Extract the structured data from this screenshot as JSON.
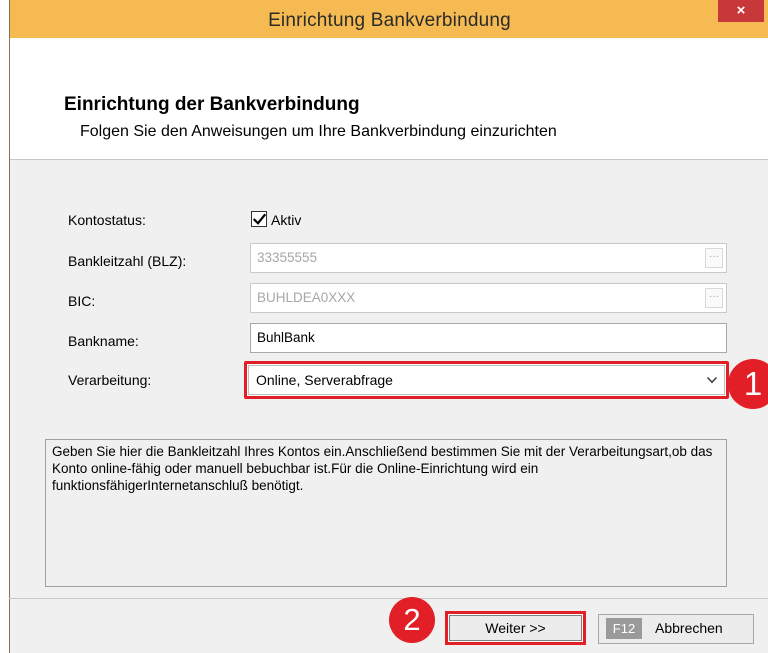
{
  "window": {
    "title": "Einrichtung Bankverbindung",
    "close_glyph": "×"
  },
  "header": {
    "title": "Einrichtung der Bankverbindung",
    "subtitle": "Folgen Sie den Anweisungen um Ihre Bankverbindung einzurichten"
  },
  "form": {
    "kontostatus_label": "Kontostatus:",
    "aktiv_label": "Aktiv",
    "aktiv_checked": true,
    "blz_label": "Bankleitzahl (BLZ):",
    "blz_value": "33355555",
    "bic_label": "BIC:",
    "bic_value": "BUHLDEA0XXX",
    "bankname_label": "Bankname:",
    "bankname_value": "BuhlBank",
    "verarbeitung_label": "Verarbeitung:",
    "verarbeitung_value": "Online, Serverabfrage",
    "ellipsis_glyph": "···"
  },
  "info_text": "Geben Sie hier die Bankleitzahl Ihres Kontos ein.Anschließend bestimmen Sie mit der Verarbeitungsart,ob das Konto online-fähig oder manuell bebuchbar ist.Für die Online-Einrichtung wird ein funktionsfähigerInternetanschluß benötigt.",
  "buttons": {
    "next_label": "Weiter >>",
    "cancel_key": "F12",
    "cancel_label": "Abbrechen"
  },
  "annotations": {
    "badge_1": "1",
    "badge_2": "2"
  },
  "colors": {
    "titlebar": "#f5bb52",
    "close_button": "#c7383a",
    "highlight": "#e21f26"
  },
  "icons": {
    "close": "close-icon",
    "checkbox": "checkmark-icon",
    "dropdown": "chevron-down-icon",
    "ellipsis": "ellipsis-icon"
  }
}
